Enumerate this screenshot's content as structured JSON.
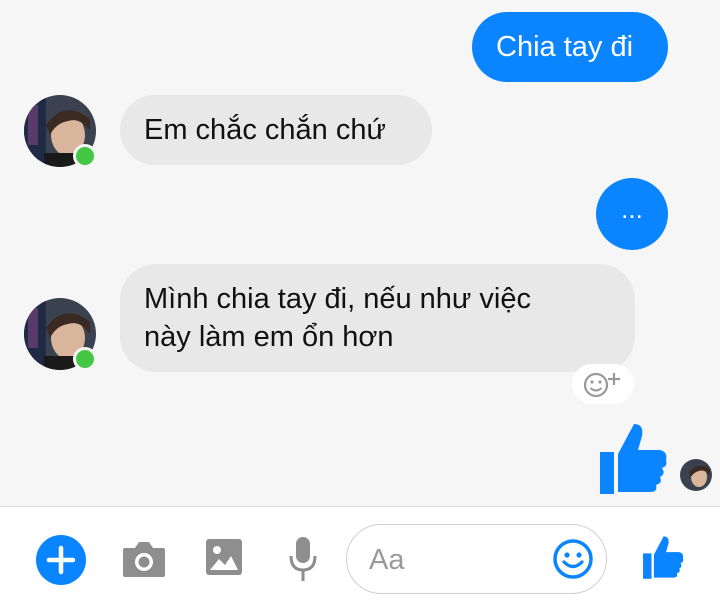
{
  "colors": {
    "accent": "#0a84ff",
    "incoming_bubble": "#e8e8e8",
    "background": "#f6f6f6",
    "online": "#44c744",
    "icon_gray": "#8e8e8e"
  },
  "messages": [
    {
      "sender": "me",
      "text": "Chia tay đi"
    },
    {
      "sender": "contact",
      "text": "Em chắc chắn chứ"
    },
    {
      "sender": "me",
      "text": "..."
    },
    {
      "sender": "contact",
      "lines": [
        "Mình chia tay đi, nếu như việc",
        "này làm em ổn hơn"
      ]
    }
  ],
  "icons": {
    "reaction": "add-reaction-icon",
    "large_like": "thumbs-up-icon",
    "plus": "plus-icon",
    "camera": "camera-icon",
    "gallery": "image-icon",
    "mic": "microphone-icon",
    "emoji": "smiley-icon",
    "like": "thumbs-up-icon"
  },
  "composer": {
    "placeholder": "Aa"
  }
}
